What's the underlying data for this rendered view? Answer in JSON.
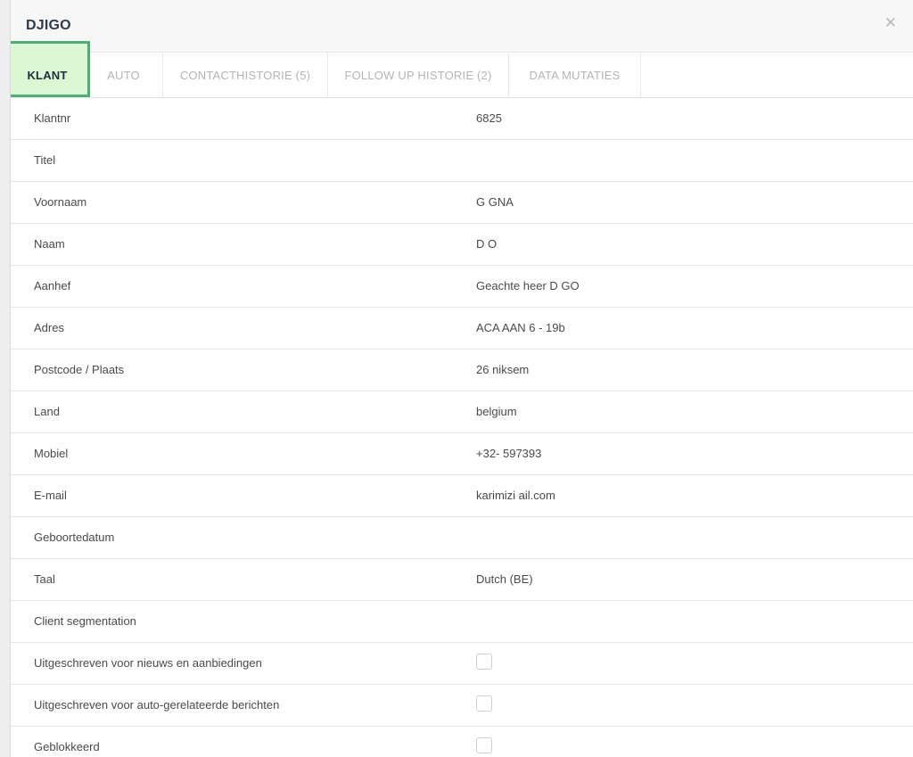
{
  "modal": {
    "title": "DJIGO",
    "close_icon": "close-icon",
    "close_glyph": "✕"
  },
  "tabs": [
    {
      "label": "KLANT",
      "active": true
    },
    {
      "label": "AUTO",
      "active": false
    },
    {
      "label": "CONTACTHISTORIE (5)",
      "active": false
    },
    {
      "label": "FOLLOW UP HISTORIE (2)",
      "active": false
    },
    {
      "label": "DATA MUTATIES",
      "active": false
    }
  ],
  "fields": [
    {
      "label": "Klantnr",
      "value": "6825"
    },
    {
      "label": "Titel",
      "value": ""
    },
    {
      "label": "Voornaam",
      "value": "G   GNA"
    },
    {
      "label": "Naam",
      "value": "D   O"
    },
    {
      "label": "Aanhef",
      "value": "Geachte heer D   GO"
    },
    {
      "label": "Adres",
      "value": "ACA      AAN 6 - 19b"
    },
    {
      "label": "Postcode / Plaats",
      "value": "26      niksem"
    },
    {
      "label": "Land",
      "value": "belgium"
    },
    {
      "label": "Mobiel",
      "value": "+32-   597393"
    },
    {
      "label": "E-mail",
      "value": "karimizi            ail.com"
    },
    {
      "label": "Geboortedatum",
      "value": ""
    },
    {
      "label": "Taal",
      "value": "Dutch (BE)"
    },
    {
      "label": "Client segmentation",
      "value": ""
    }
  ],
  "checkbox_fields": [
    {
      "label": "Uitgeschreven voor nieuws en aanbiedingen",
      "checked": false
    },
    {
      "label": "Uitgeschreven voor auto-gerelateerde berichten",
      "checked": false
    },
    {
      "label": "Geblokkeerd",
      "checked": false
    }
  ],
  "colors": {
    "active_tab_highlight": "#dcf7d4",
    "active_tab_border": "#4fae78",
    "title": "#2e3b4a",
    "inactive_tab": "#b5b5b5"
  }
}
